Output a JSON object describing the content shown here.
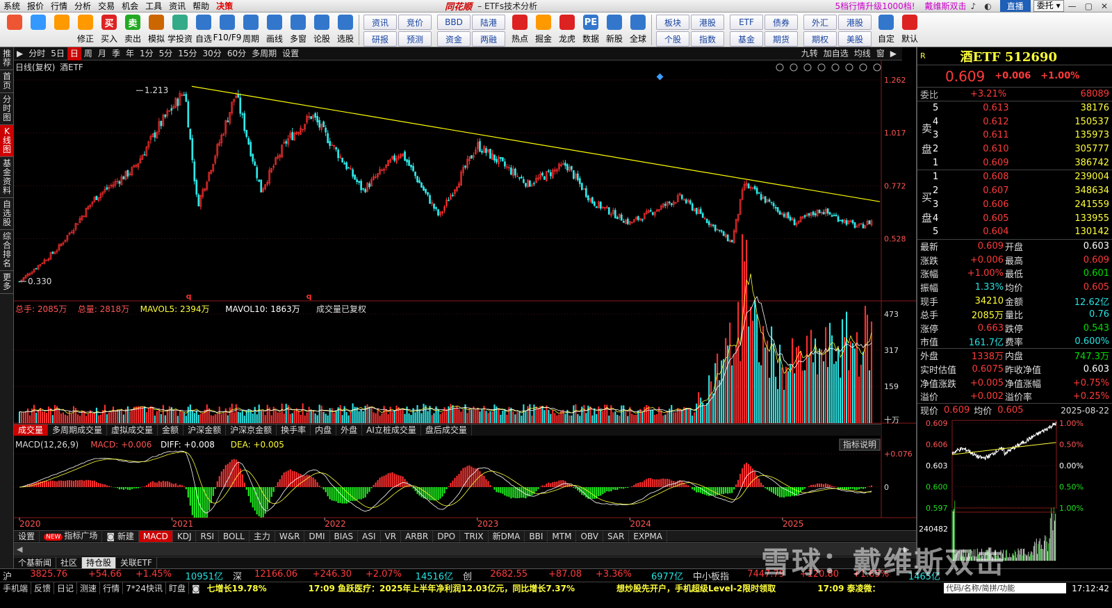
{
  "menu": {
    "items": [
      "系统",
      "报价",
      "行情",
      "分析",
      "交易",
      "机会",
      "工具",
      "资讯",
      "帮助",
      "决策"
    ],
    "highlight_index": 9,
    "brand": "同花顺",
    "window_title": "ETFs技术分析",
    "promo": "5档行情升级1000档!",
    "author": "戴维斯双击",
    "login_btn": "直播",
    "delegate_btn": "委托"
  },
  "toolbar": {
    "buttons": [
      {
        "label": "",
        "icon": "layout-icon",
        "color": "#e53"
      },
      {
        "label": "",
        "icon": "mascot-icon",
        "color": "#39f"
      },
      {
        "label": "",
        "icon": "back-arrow-icon",
        "color": "#f90"
      },
      {
        "label": "修正",
        "icon": "fix-icon",
        "color": "#f90"
      },
      {
        "label": "买入",
        "icon": "buy-icon",
        "color": "#d22",
        "text": "买"
      },
      {
        "label": "卖出",
        "icon": "sell-icon",
        "color": "#2a2",
        "text": "卖"
      },
      {
        "label": "模拟",
        "icon": "hammer-icon",
        "color": "#c60"
      },
      {
        "label": "学投资",
        "icon": "learn-icon",
        "color": "#3a8"
      },
      {
        "label": "自选",
        "icon": "star-icon",
        "color": "#37c"
      },
      {
        "label": "F10/F9",
        "icon": "f10-icon",
        "color": "#37c"
      },
      {
        "label": "周期",
        "icon": "clock-icon",
        "color": "#37c"
      },
      {
        "label": "画线",
        "icon": "pen-icon",
        "color": "#37c"
      },
      {
        "label": "多窗",
        "icon": "multiwin-icon",
        "color": "#37c"
      },
      {
        "label": "论股",
        "icon": "discuss-icon",
        "color": "#37c"
      },
      {
        "label": "选股",
        "icon": "search-icon",
        "color": "#37c"
      }
    ],
    "grid1": [
      "资讯",
      "竞价",
      "研报",
      "预测"
    ],
    "grid2": [
      "BBD",
      "陆港",
      "资金",
      "两融"
    ],
    "buttons2": [
      {
        "label": "热点",
        "icon": "hot-icon",
        "color": "#d22"
      },
      {
        "label": "掘金",
        "icon": "gold-icon",
        "color": "#f90"
      },
      {
        "label": "龙虎",
        "icon": "dragon-icon",
        "color": "#d22"
      },
      {
        "label": "数据",
        "icon": "pe-icon",
        "color": "#37c",
        "text": "PE"
      },
      {
        "label": "新股",
        "icon": "ipo-icon",
        "color": "#37c"
      },
      {
        "label": "全球",
        "icon": "globe-icon",
        "color": "#37c"
      }
    ],
    "grid3": [
      "板块",
      "港股",
      "个股",
      "指数"
    ],
    "grid4": [
      "ETF",
      "债券",
      "基金",
      "期货"
    ],
    "grid5": [
      "外汇",
      "港股",
      "期权",
      "美股"
    ],
    "buttons3": [
      {
        "label": "自定",
        "icon": "custom-icon",
        "color": "#37c"
      },
      {
        "label": "默认",
        "icon": "home-icon",
        "color": "#d22"
      }
    ]
  },
  "leftnav": [
    "推荐",
    "首页",
    "分时图",
    "K线图",
    "基金资料",
    "自选股",
    "综合排名",
    "更多"
  ],
  "leftnav_active": 3,
  "periods": [
    "分时",
    "5日",
    "日",
    "周",
    "月",
    "季",
    "年",
    "1分",
    "5分",
    "15分",
    "30分",
    "60分",
    "多周期",
    "设置"
  ],
  "period_active": 2,
  "period_right": [
    "九转",
    "加自选",
    "均线",
    "窗"
  ],
  "kline": {
    "title": "日线(复权)",
    "security": "酒ETF",
    "price_axis": [
      "1.262",
      "1.017",
      "0.772",
      "0.528"
    ],
    "high_mark": "1.213",
    "low_mark": "0.330",
    "q_marks": [
      "q",
      "q"
    ]
  },
  "volume": {
    "total_label": "总手: 2085万",
    "volume_label": "总量: 2818万",
    "mavol5": "MAVOL5: 2394万",
    "mavol10": "MAVOL10: 1863万",
    "note": "成交量已复权",
    "axis": [
      "473",
      "317",
      "159",
      "十万"
    ],
    "tabs": [
      "成交量",
      "多周期成交量",
      "虚拟成交量",
      "金额",
      "沪深金额",
      "沪深京金额",
      "换手率",
      "内盘",
      "外盘",
      "AI立桩成交量",
      "盘后成交量"
    ]
  },
  "macd": {
    "name": "MACD(12,26,9)",
    "macd": "MACD: +0.006",
    "diff": "DIFF: +0.008",
    "dea": "DEA: +0.005",
    "axis_top": "+0.076",
    "axis_zero": "0",
    "help_btn": "指标说明"
  },
  "years": [
    "2020",
    "2021",
    "2022",
    "2023",
    "2024",
    "2025"
  ],
  "indicator_tabs": [
    "设置",
    "指标广场",
    "新建",
    "MACD",
    "KDJ",
    "RSI",
    "BOLL",
    "主力",
    "W&R",
    "DMI",
    "BIAS",
    "ASI",
    "VR",
    "ARBR",
    "DPO",
    "TRIX",
    "新DMA",
    "BBI",
    "MTM",
    "OBV",
    "SAR",
    "EXPMA"
  ],
  "indicator_active": 3,
  "new_badge": "NEW",
  "bottom_tabs": [
    "个基新闻",
    "社区",
    "持仓股",
    "关联ETF"
  ],
  "bottom_active": 2,
  "quote": {
    "tag": "R",
    "name": "酒ETF 512690",
    "price": "0.609",
    "change": "+0.006",
    "pct": "+1.00%",
    "weibi_label": "委比",
    "weibi": "+3.21%",
    "weicha": "68089",
    "sell_label": "卖盘",
    "buy_label": "买盘",
    "sells": [
      {
        "lv": "5",
        "p": "0.613",
        "v": "38176"
      },
      {
        "lv": "4",
        "p": "0.612",
        "v": "150537"
      },
      {
        "lv": "3",
        "p": "0.611",
        "v": "135973"
      },
      {
        "lv": "2",
        "p": "0.610",
        "v": "305777"
      },
      {
        "lv": "1",
        "p": "0.609",
        "v": "386742"
      }
    ],
    "buys": [
      {
        "lv": "1",
        "p": "0.608",
        "v": "239004"
      },
      {
        "lv": "2",
        "p": "0.607",
        "v": "348634"
      },
      {
        "lv": "3",
        "p": "0.606",
        "v": "241559"
      },
      {
        "lv": "4",
        "p": "0.605",
        "v": "133955"
      },
      {
        "lv": "5",
        "p": "0.604",
        "v": "130142"
      }
    ],
    "stats": [
      {
        "k1": "最新",
        "v1": "0.609",
        "c1": "red",
        "k2": "开盘",
        "v2": "0.603",
        "c2": "white"
      },
      {
        "k1": "涨跌",
        "v1": "+0.006",
        "c1": "red",
        "k2": "最高",
        "v2": "0.609",
        "c2": "red"
      },
      {
        "k1": "涨幅",
        "v1": "+1.00%",
        "c1": "red",
        "k2": "最低",
        "v2": "0.601",
        "c2": "green"
      },
      {
        "k1": "振幅",
        "v1": "1.33%",
        "c1": "cyan",
        "k2": "均价",
        "v2": "0.605",
        "c2": "red"
      },
      {
        "k1": "现手",
        "v1": "34210",
        "c1": "yel",
        "k2": "金额",
        "v2": "12.62亿",
        "c2": "cyan"
      },
      {
        "k1": "总手",
        "v1": "2085万",
        "c1": "yel",
        "k2": "量比",
        "v2": "0.76",
        "c2": "cyan"
      },
      {
        "k1": "涨停",
        "v1": "0.663",
        "c1": "red",
        "k2": "跌停",
        "v2": "0.543",
        "c2": "green"
      },
      {
        "k1": "市值",
        "v1": "161.7亿",
        "c1": "cyan",
        "k2": "费率",
        "v2": "0.600%",
        "c2": "cyan"
      },
      {
        "k1": "外盘",
        "v1": "1338万",
        "c1": "red",
        "k2": "内盘",
        "v2": "747.3万",
        "c2": "green"
      },
      {
        "k1": "实时估值",
        "v1": "0.6075",
        "c1": "red",
        "k2": "昨收净值",
        "v2": "0.603",
        "c2": "white"
      },
      {
        "k1": "净值涨跌",
        "v1": "+0.005",
        "c1": "red",
        "k2": "净值涨幅",
        "v2": "+0.75%",
        "c2": "red"
      },
      {
        "k1": "溢价",
        "v1": "+0.002",
        "c1": "red",
        "k2": "溢价率",
        "v2": "+0.25%",
        "c2": "red"
      }
    ],
    "mini_label": "现价",
    "mini_price": "0.609",
    "mini_avg_label": "均价",
    "mini_avg": "0.605",
    "mini_date": "2025-08-22",
    "mini_left": [
      "0.609",
      "0.606",
      "0.603",
      "0.600",
      "0.597"
    ],
    "mini_right": [
      "1.00%",
      "0.50%",
      "0.00%",
      "0.50%",
      "1.00%"
    ],
    "mini_vol": "240482"
  },
  "indexbar": [
    {
      "name": "沪",
      "v": "3825.76",
      "chg": "+54.66",
      "pct": "+1.45%",
      "amt": "10951亿"
    },
    {
      "name": "深",
      "v": "12166.06",
      "chg": "+246.30",
      "pct": "+2.07%",
      "amt": "14516亿"
    },
    {
      "name": "创",
      "v": "2682.55",
      "chg": "+87.08",
      "pct": "+3.36%",
      "amt": "6977亿"
    },
    {
      "name": "中小板指",
      "v": "7447.79",
      "chg": "+120.80",
      "pct": "+1.65%",
      "amt": "1465亿"
    }
  ],
  "statusbar": {
    "items": [
      "手机端",
      "反馈",
      "日记",
      "测速",
      "行情",
      "7*24快讯",
      "盯盘"
    ],
    "ticker1": "七增长19.78%",
    "ticker2": "17:09 鱼跃医疗：2025年上半年净利润12.03亿元，同比增长7.37%",
    "ticker3": "想炒股先开户，手机超级Level-2限时领取",
    "ticker4": "17:09 泰凌微：",
    "search_hint": "代码/名称/简拼/功能",
    "time": "17:12:42"
  },
  "watermark": "雪球：戴维斯双击",
  "chart_data": {
    "type": "candlestick",
    "title": "日线(复权) 酒ETF",
    "x_years": [
      "2020",
      "2021",
      "2022",
      "2023",
      "2024",
      "2025"
    ],
    "ylim": [
      0.33,
      1.262
    ],
    "close_anchors": [
      {
        "t": "2020-01",
        "v": 0.33
      },
      {
        "t": "2020-04",
        "v": 0.48
      },
      {
        "t": "2020-07",
        "v": 0.72
      },
      {
        "t": "2020-10",
        "v": 0.85
      },
      {
        "t": "2020-12",
        "v": 1.05
      },
      {
        "t": "2021-02",
        "v": 1.213
      },
      {
        "t": "2021-03",
        "v": 0.68
      },
      {
        "t": "2021-05",
        "v": 1.02
      },
      {
        "t": "2021-06",
        "v": 1.2
      },
      {
        "t": "2021-08",
        "v": 0.75
      },
      {
        "t": "2021-10",
        "v": 0.98
      },
      {
        "t": "2021-12",
        "v": 1.1
      },
      {
        "t": "2022-04",
        "v": 0.75
      },
      {
        "t": "2022-07",
        "v": 0.93
      },
      {
        "t": "2022-10",
        "v": 0.63
      },
      {
        "t": "2023-01",
        "v": 0.96
      },
      {
        "t": "2023-05",
        "v": 0.78
      },
      {
        "t": "2023-08",
        "v": 0.87
      },
      {
        "t": "2023-10",
        "v": 0.7
      },
      {
        "t": "2024-01",
        "v": 0.6
      },
      {
        "t": "2024-05",
        "v": 0.72
      },
      {
        "t": "2024-09",
        "v": 0.51
      },
      {
        "t": "2024-10",
        "v": 0.78
      },
      {
        "t": "2025-02",
        "v": 0.6
      },
      {
        "t": "2025-04",
        "v": 0.66
      },
      {
        "t": "2025-07",
        "v": 0.58
      },
      {
        "t": "2025-08",
        "v": 0.609
      }
    ],
    "trendline": [
      {
        "t": "2021-02",
        "v": 1.213
      },
      {
        "t": "2025-08",
        "v": 0.609
      }
    ],
    "volume_axis": [
      0,
      159,
      317,
      473
    ],
    "volume_unit": "十万",
    "volume_anchors": [
      {
        "t": "2020-01",
        "v": 55
      },
      {
        "t": "2022-01",
        "v": 60
      },
      {
        "t": "2024-06",
        "v": 55
      },
      {
        "t": "2024-10",
        "v": 430
      },
      {
        "t": "2025-01",
        "v": 240
      },
      {
        "t": "2025-08",
        "v": 370
      }
    ],
    "macd_axis": [
      0,
      0.076
    ],
    "macd_last": {
      "macd": 0.006,
      "diff": 0.008,
      "dea": 0.005
    }
  }
}
